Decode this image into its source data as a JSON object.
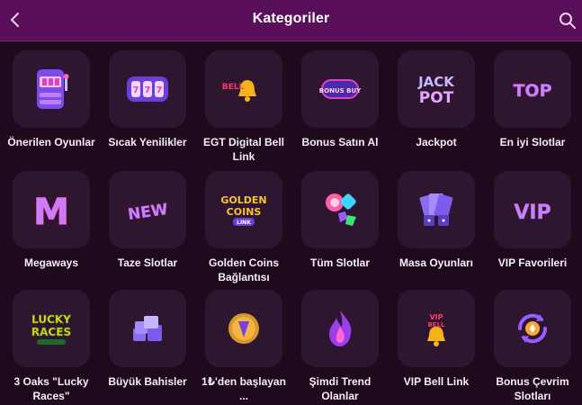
{
  "header": {
    "title": "Kategoriler",
    "back_icon": "chevron-left-icon",
    "search_icon": "search-icon"
  },
  "colors": {
    "header_bg": "#5a0f5a",
    "page_bg": "#1e0a1c",
    "tile_bg": "#2f1630",
    "accent_pink": "#e040c8",
    "accent_purple": "#8a5cf6"
  },
  "categories": [
    {
      "label": "Önerilen Oyunlar",
      "icon": "slot-machine-icon"
    },
    {
      "label": "Sıcak Yenilikler",
      "icon": "slot-reels-icon"
    },
    {
      "label": "EGT Digital Bell Link",
      "icon": "bell-link-icon",
      "icon_text": "BELL"
    },
    {
      "label": "Bonus Satın Al",
      "icon": "bonus-buy-icon",
      "icon_text": "BONUS BUY"
    },
    {
      "label": "Jackpot",
      "icon": "jackpot-icon",
      "icon_text": "JACK POT"
    },
    {
      "label": "En iyi Slotlar",
      "icon": "top-icon",
      "icon_text": "TOP"
    },
    {
      "label": "Megaways",
      "icon": "megaways-m-icon",
      "icon_text": "M"
    },
    {
      "label": "Taze Slotlar",
      "icon": "new-icon",
      "icon_text": "NEW"
    },
    {
      "label": "Golden Coins Bağlantısı",
      "icon": "golden-coins-icon",
      "icon_text": "GOLDEN COINS LINK"
    },
    {
      "label": "Tüm Slotlar",
      "icon": "candy-icon"
    },
    {
      "label": "Masa Oyunları",
      "icon": "cards-dice-icon"
    },
    {
      "label": "VIP Favorileri",
      "icon": "vip-icon",
      "icon_text": "VIP"
    },
    {
      "label": "3 Oaks \"Lucky Races\"",
      "icon": "lucky-races-icon",
      "icon_text": "LUCKY RACES"
    },
    {
      "label": "Büyük Bahisler",
      "icon": "chip-stacks-icon"
    },
    {
      "label": "1₺'den başlayan ...",
      "icon": "coin-icon"
    },
    {
      "label": "Şimdi Trend Olanlar",
      "icon": "flame-icon"
    },
    {
      "label": "VIP Bell Link",
      "icon": "vip-bell-icon",
      "icon_text": "VIP BELL"
    },
    {
      "label": "Bonus Çevrim Slotları",
      "icon": "bonus-cycle-icon"
    }
  ]
}
